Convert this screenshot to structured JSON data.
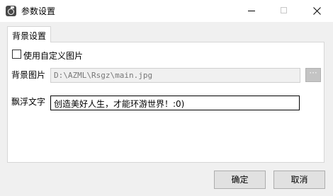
{
  "window": {
    "title": "参数设置"
  },
  "tabs": [
    {
      "label": "背景设置"
    }
  ],
  "settings": {
    "use_custom_image_label": "使用自定义图片",
    "use_custom_image_checked": false,
    "background_image": {
      "label": "背景图片",
      "value": "D:\\AZML\\Rsgz\\main.jpg",
      "browse_label": "···"
    },
    "floating_text": {
      "label": "飘浮文字",
      "value": "创造美好人生，才能环游世界！:0)"
    }
  },
  "buttons": {
    "ok": "确定",
    "cancel": "取消"
  }
}
